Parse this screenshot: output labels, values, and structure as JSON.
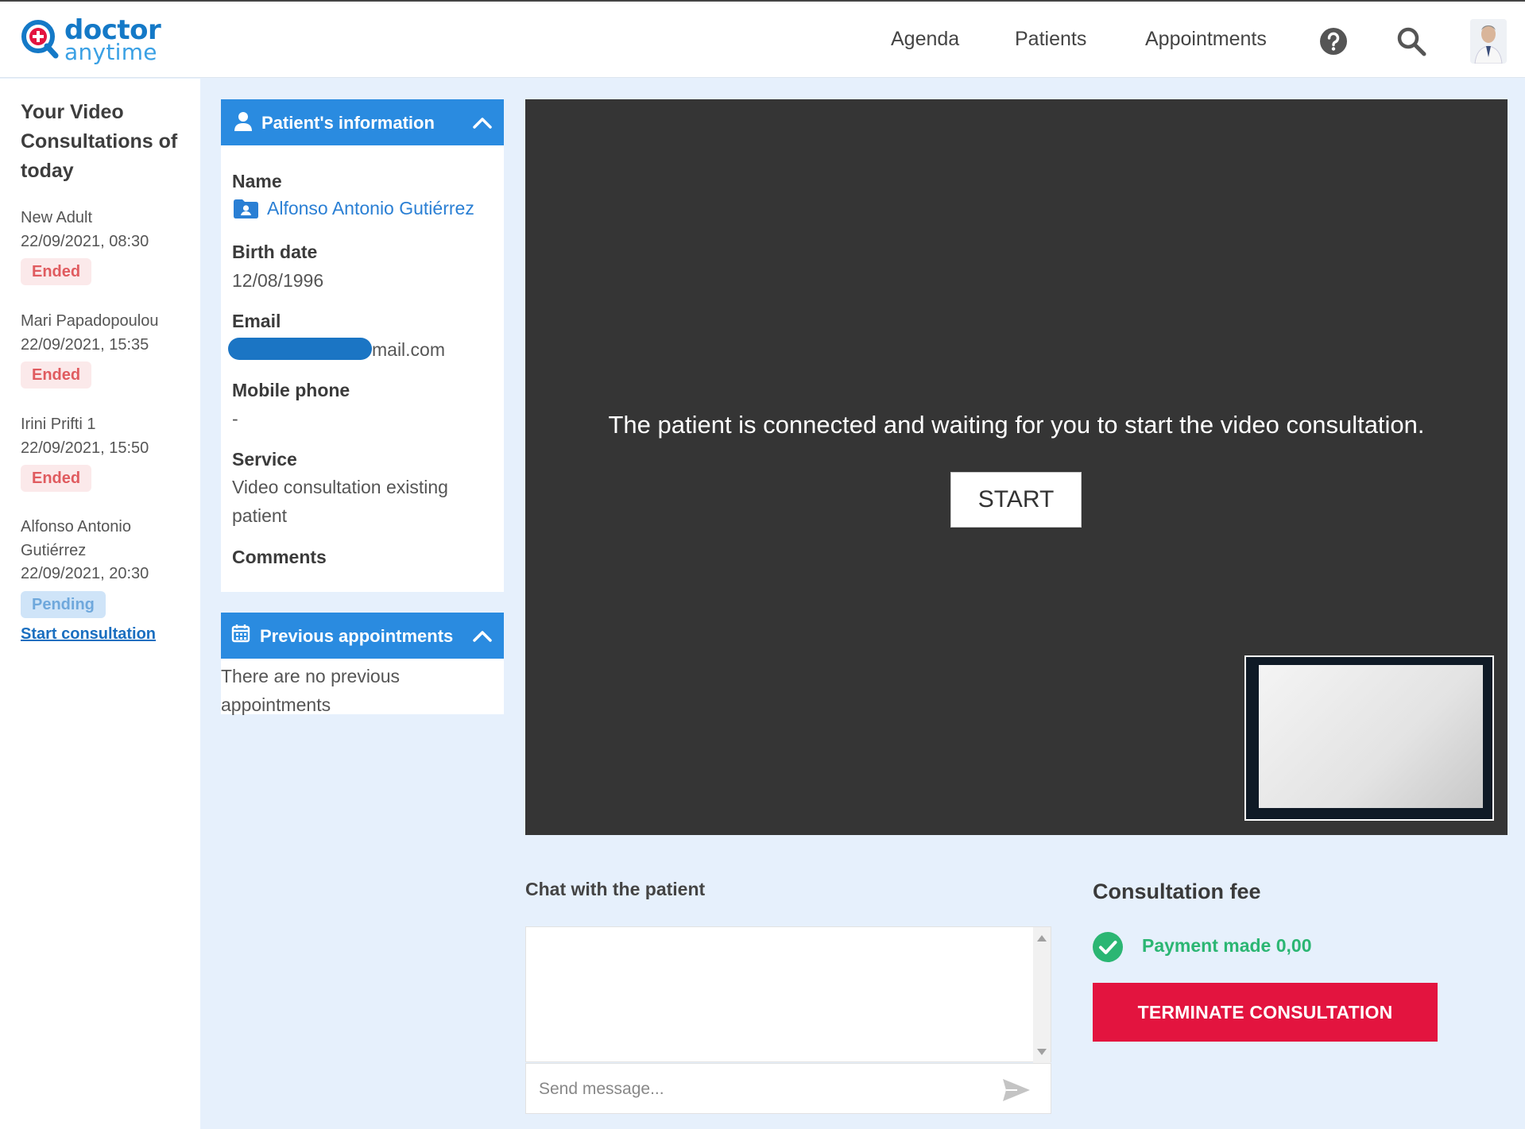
{
  "brand": {
    "logo_word1": "doctor",
    "logo_word2": "anytime",
    "primary_color": "#1479c7"
  },
  "nav": {
    "agenda": "Agenda",
    "patients": "Patients",
    "appointments": "Appointments",
    "icons": [
      "help-icon",
      "search-icon",
      "avatar"
    ]
  },
  "sidebar": {
    "title": "Your Video Consultations of today",
    "appointments": [
      {
        "name": "New Adult",
        "datetime": "22/09/2021, 08:30",
        "status": "Ended"
      },
      {
        "name": "Mari Papadopoulou",
        "datetime": "22/09/2021, 15:35",
        "status": "Ended"
      },
      {
        "name": "Irini Prifti 1",
        "datetime": "22/09/2021, 15:50",
        "status": "Ended"
      },
      {
        "name": "Alfonso Antonio Gutiérrez",
        "datetime": "22/09/2021, 20:30",
        "status": "Pending",
        "action": "Start consultation"
      }
    ]
  },
  "patient_info": {
    "header": "Patient's information",
    "name_label": "Name",
    "name": "Alfonso Antonio Gutiérrez",
    "birth_label": "Birth date",
    "birth": "12/08/1996",
    "email_label": "Email",
    "email_visible": "mail.com",
    "mobile_label": "Mobile phone",
    "mobile": "-",
    "service_label": "Service",
    "service": "Video consultation existing patient",
    "comments_label": "Comments"
  },
  "previous": {
    "header": "Previous appointments",
    "empty": "There are no previous appointments"
  },
  "video": {
    "message": "The patient is connected and waiting for you to start the video consultation.",
    "start": "START"
  },
  "chat": {
    "title": "Chat with the patient",
    "placeholder": "Send message..."
  },
  "fee": {
    "title": "Consultation fee",
    "payment": "Payment made 0,00",
    "terminate": "TERMINATE CONSULTATION",
    "terminate_color": "#e3143f",
    "paid_color": "#2bb673"
  }
}
